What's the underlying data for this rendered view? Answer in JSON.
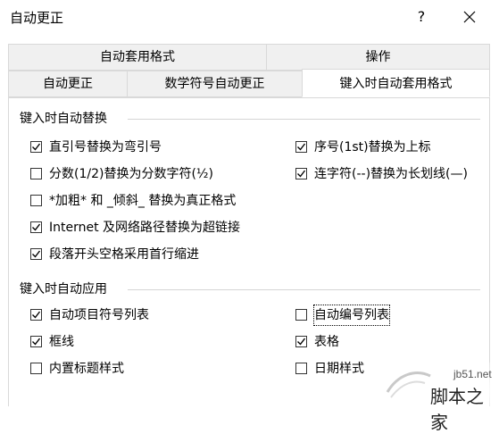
{
  "window": {
    "title": "自动更正",
    "help_label": "?"
  },
  "tabs": {
    "row1": [
      "自动套用格式",
      "操作"
    ],
    "row2": [
      "自动更正",
      "数学符号自动更正",
      "键入时自动套用格式"
    ],
    "active": "键入时自动套用格式"
  },
  "group_replace": {
    "title": "键入时自动替换",
    "options": [
      {
        "label": "直引号替换为弯引号",
        "checked": true
      },
      {
        "label": "序号(1st)替换为上标",
        "checked": true
      },
      {
        "label": "分数(1/2)替换为分数字符(½)",
        "checked": false
      },
      {
        "label": "连字符(--)替换为长划线(—)",
        "checked": true
      },
      {
        "label": "*加粗* 和 _倾斜_ 替换为真正格式",
        "checked": false
      },
      {
        "label": "Internet 及网络路径替换为超链接",
        "checked": true
      },
      {
        "label": "段落开头空格采用首行缩进",
        "checked": true
      }
    ]
  },
  "group_apply": {
    "title": "键入时自动应用",
    "options": [
      {
        "label": "自动项目符号列表",
        "checked": true
      },
      {
        "label": "自动编号列表",
        "checked": false
      },
      {
        "label": "框线",
        "checked": true
      },
      {
        "label": "表格",
        "checked": true
      },
      {
        "label": "内置标题样式",
        "checked": false
      },
      {
        "label": "日期样式",
        "checked": false
      }
    ]
  },
  "watermark": {
    "url": "jb51.net",
    "name": "脚本之家"
  }
}
